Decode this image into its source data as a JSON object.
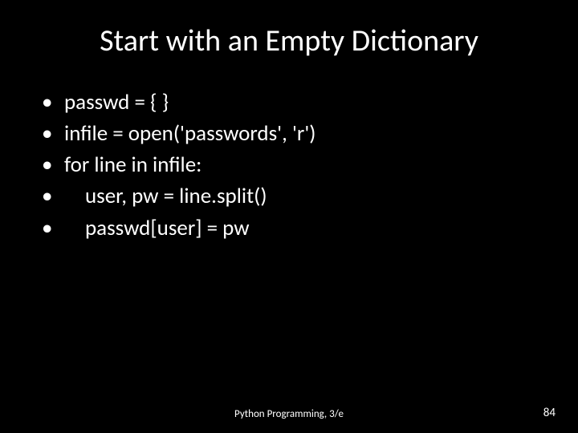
{
  "title": "Start with an Empty Dictionary",
  "bullets": [
    {
      "text": "passwd = { }",
      "indent": false
    },
    {
      "text": "infile = open('passwords', 'r')",
      "indent": false
    },
    {
      "text": "for line in infile:",
      "indent": false
    },
    {
      "text": "user, pw = line.split()",
      "indent": true
    },
    {
      "text": "passwd[user] = pw",
      "indent": true
    }
  ],
  "footer": "Python Programming, 3/e",
  "page_number": "84"
}
